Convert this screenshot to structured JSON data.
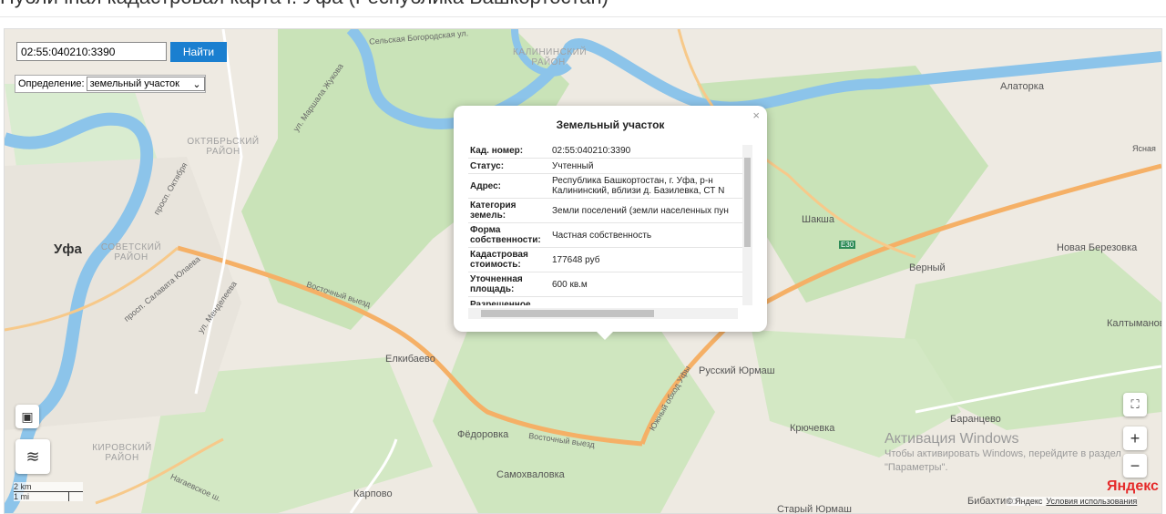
{
  "page": {
    "title": "Публичная кадастровая карта г. Уфа (Республика Башкортостан)"
  },
  "search": {
    "value": "02:55:040210:3390",
    "button_label": "Найти"
  },
  "definition": {
    "label": "Определение:",
    "selected": "земельный участок"
  },
  "popup": {
    "title": "Земельный участок",
    "close": "×",
    "rows": [
      {
        "key": "Кад. номер:",
        "value": "02:55:040210:3390"
      },
      {
        "key": "Статус:",
        "value": "Учтенный"
      },
      {
        "key": "Адрес:",
        "value": "Республика Башкортостан, г. Уфа, р-н Калининский, вблизи д. Базилевка, СТ N"
      },
      {
        "key": "Категория земель:",
        "value": "Земли поселений (земли населенных пун"
      },
      {
        "key": "Форма собственности:",
        "value": "Частная собственность"
      },
      {
        "key": "Кадастровая стоимость:",
        "value": "177648 руб"
      },
      {
        "key": "Уточненная площадь:",
        "value": "600 кв.м"
      },
      {
        "key": "Разрешенное",
        "value": ""
      }
    ]
  },
  "map_labels": {
    "ufa": "Уфа",
    "sovetsky": "СОВЕТСКИЙ РАЙОН",
    "oktyabrsky": "ОКТЯБРЬСКИЙ РАЙОН",
    "kirovsky": "КИРОВСКИЙ РАЙОН",
    "kalininsky": "КАЛИНИНСКИЙ РАЙОН",
    "alatorka": "Алаторка",
    "shaksha": "Шакша",
    "yasnaya": "Ясная",
    "novaya_berezovka": "Новая Березовка",
    "verny": "Верный",
    "kaltymanovo": "Калтыманов",
    "russky_yurmash": "Русский Юрмаш",
    "elkibaevo": "Елкибаево",
    "fedorovka": "Фёдоровка",
    "samokhvalovka": "Самохваловка",
    "karpovo": "Карпово",
    "kryuchevka": "Крючевка",
    "barantsevo": "Баранцево",
    "bibakhtino": "Бибахтино",
    "stary_yurmash": "Старый Юрмаш",
    "vostochny_vyezd": "Восточный выезд",
    "selskaya": "Сельская Богородская ул.",
    "zhukova": "ул. Маршала Жукова",
    "oktyabrya": "просп. Октября",
    "salavata": "просп. Салавата Юлаева",
    "menshikova": "ул. Менделеева",
    "yuzhny_obkhod": "Южный обход Уфы",
    "nagaevskoe": "Нагаевское ш.",
    "e30": "E30"
  },
  "controls": {
    "zoom_in": "+",
    "zoom_out": "−"
  },
  "watermark": {
    "line1": "Активация Windows",
    "line2": "Чтобы активировать Windows, перейдите в раздел",
    "line3": "\"Параметры\"."
  },
  "scale": {
    "km": "2 km",
    "mi": "1 mi"
  },
  "attribution": {
    "logo": "Яндекс",
    "copyright": "© Яндекс",
    "terms": "Условия использования"
  },
  "colors": {
    "water": "#8cc4ea",
    "forest": "#c9e3b8",
    "road": "#f5b066",
    "accent": "#1a7fd0"
  }
}
